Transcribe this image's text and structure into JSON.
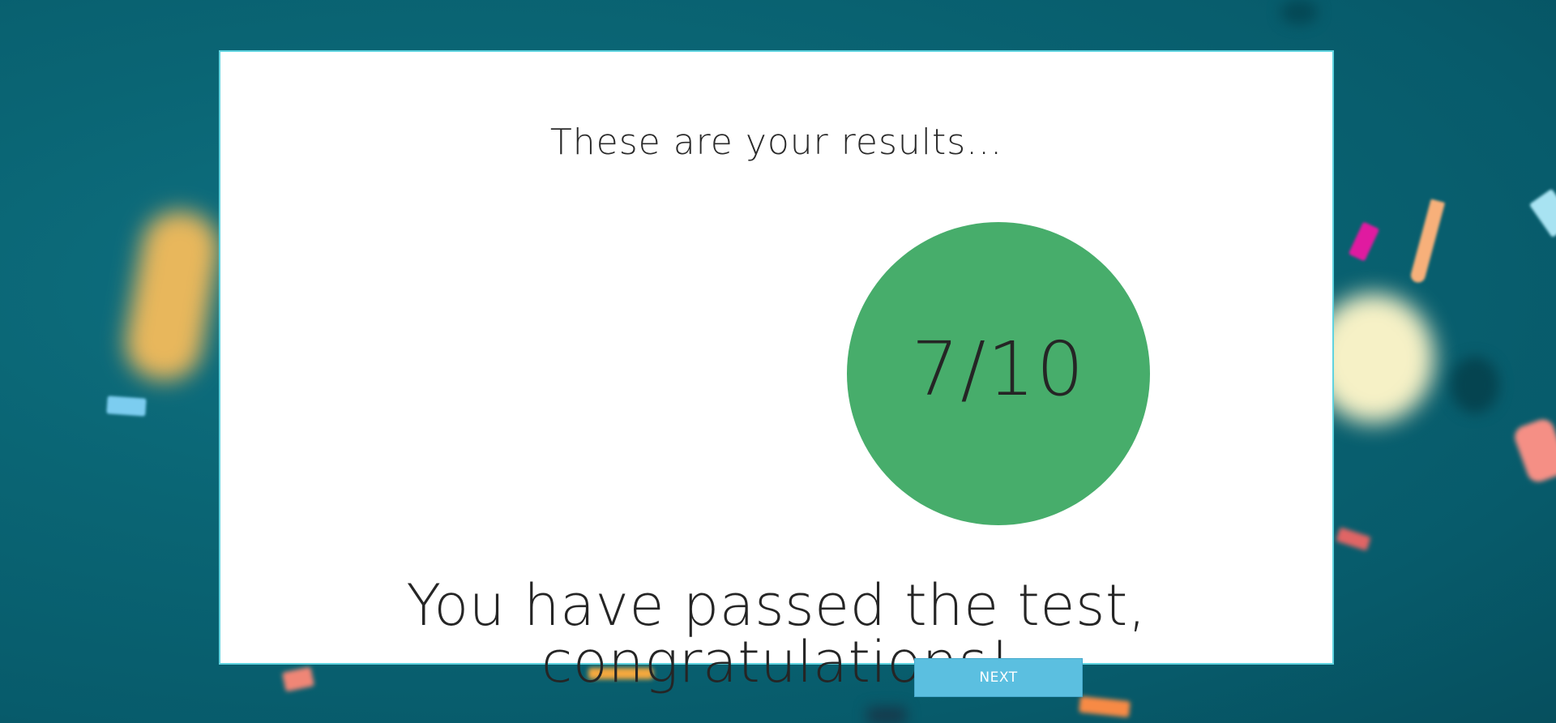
{
  "results": {
    "heading": "These are your results...",
    "score": "7/10",
    "message": "You have passed the test, congratulations!",
    "next_label": "NEXT"
  },
  "colors": {
    "background": "#0a6574",
    "card_border": "#5fd3df",
    "score_circle": "#47ad6b",
    "button": "#5bbfe0"
  }
}
